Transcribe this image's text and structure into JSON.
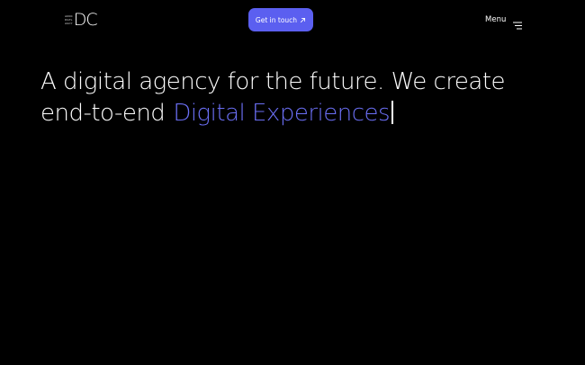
{
  "header": {
    "logo": {
      "small_lines": [
        "AKNC",
        "DGTL",
        "AGCY"
      ],
      "mark": "DC"
    },
    "cta_label": "Get in touch",
    "cta_icon": "arrow-up-right-icon",
    "menu_label": "Menu",
    "menu_icon": "menu-lines-icon"
  },
  "hero": {
    "line1": "A digital agency for the future. We create",
    "line2_prefix": "end-to-end",
    "line2_highlight": "Digital Experiences"
  },
  "colors": {
    "background": "#000000",
    "text": "#ffffff",
    "accent": "#5b5ff0",
    "highlight": "#6b6ff5"
  }
}
